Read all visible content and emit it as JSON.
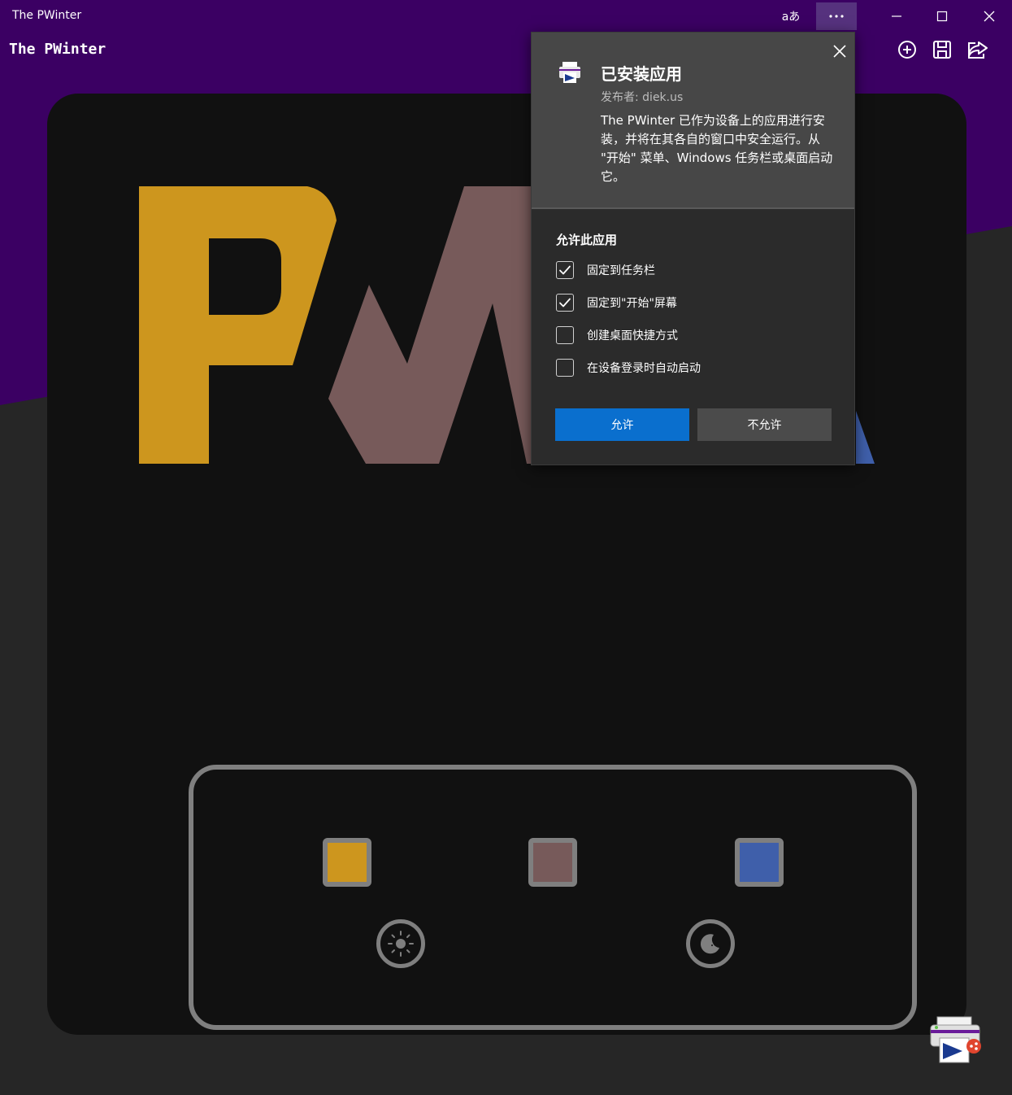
{
  "window": {
    "title": "The PWinter",
    "translate_label": "aあ",
    "colors": {
      "titlebar": "#3b0063",
      "surface": "#262626",
      "canvas": "#111111"
    }
  },
  "app": {
    "title": "The PWinter",
    "actions": [
      "add-icon",
      "save-icon",
      "share-icon"
    ]
  },
  "logo": {
    "colors": {
      "p": "#cd961e",
      "w": "#775a5a",
      "a": "#3f5faa"
    }
  },
  "palette": {
    "swatches": [
      {
        "name": "gold",
        "color": "#cd961e"
      },
      {
        "name": "mauve",
        "color": "#775a5a"
      },
      {
        "name": "blue",
        "color": "#3f5faa"
      }
    ],
    "modes": [
      "light-mode-icon",
      "dark-mode-icon"
    ]
  },
  "dialog": {
    "title": "已安装应用",
    "publisher": "发布者: diek.us",
    "description": "The PWinter 已作为设备上的应用进行安装，并将在其各自的窗口中安全运行。从 \"开始\" 菜单、Windows 任务栏或桌面启动它。",
    "section_title": "允许此应用",
    "options": [
      {
        "label": "固定到任务栏",
        "checked": true
      },
      {
        "label": "固定到\"开始\"屏幕",
        "checked": true
      },
      {
        "label": "创建桌面快捷方式",
        "checked": false
      },
      {
        "label": "在设备登录时自动启动",
        "checked": false
      }
    ],
    "allow_label": "允许",
    "deny_label": "不允许",
    "accent": "#0a6fce"
  }
}
